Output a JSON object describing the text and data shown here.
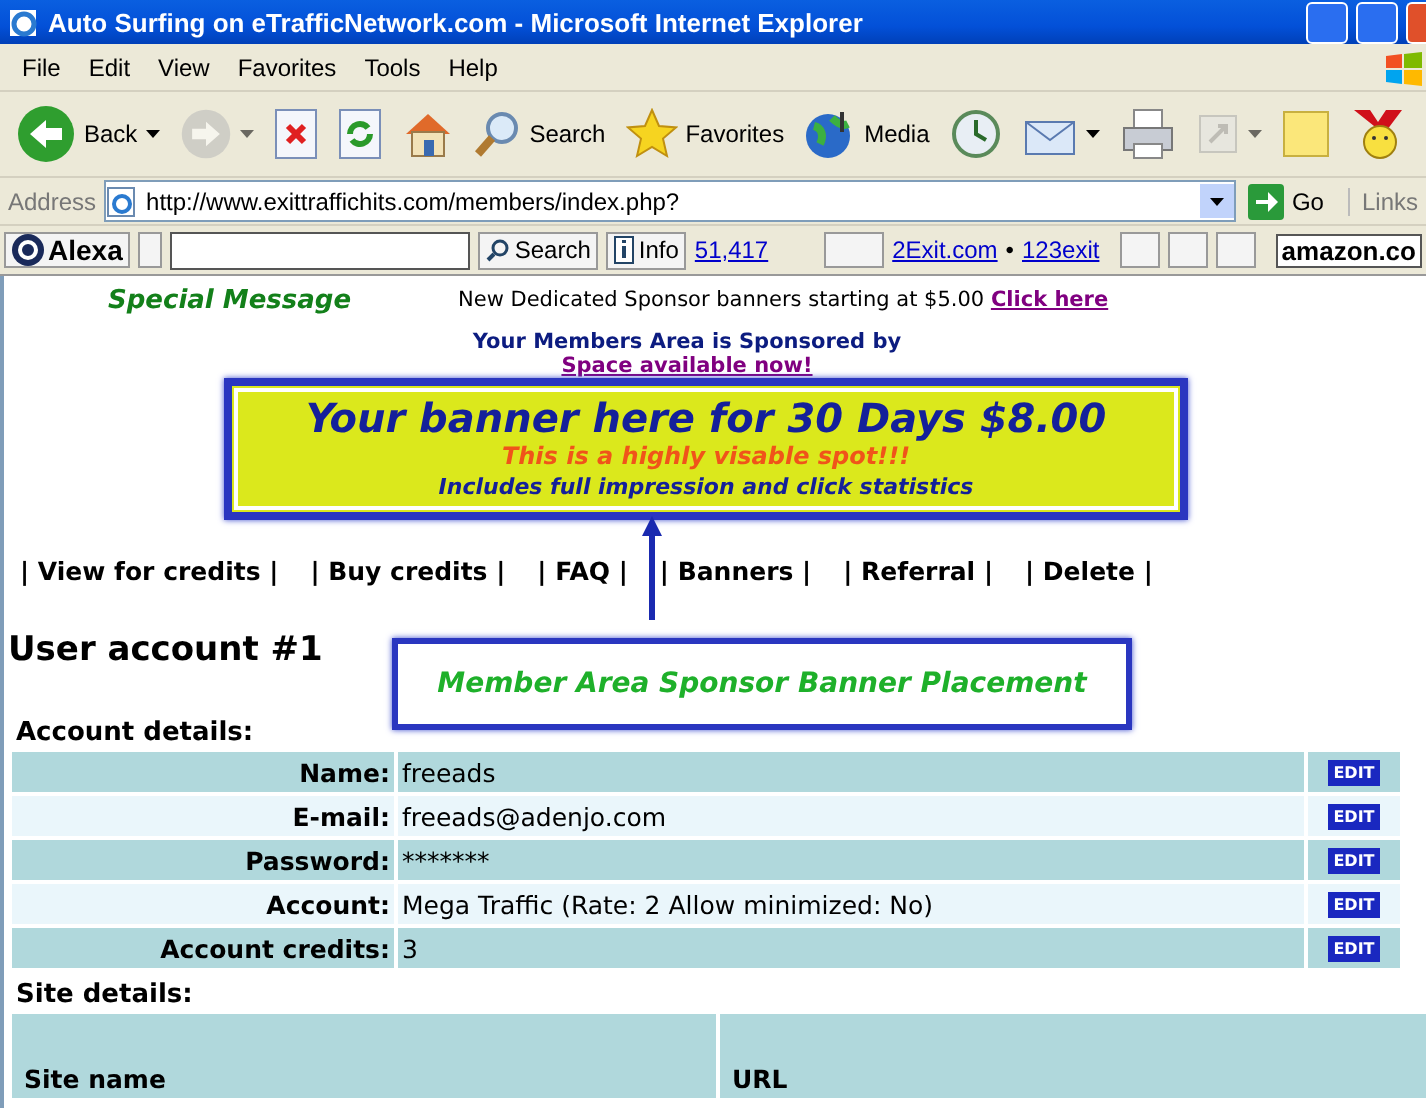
{
  "window": {
    "title": "Auto Surfing on eTrafficNetwork.com - Microsoft Internet Explorer"
  },
  "menu": [
    "File",
    "Edit",
    "View",
    "Favorites",
    "Tools",
    "Help"
  ],
  "toolbar": [
    {
      "kind": "back",
      "label": "Back",
      "dropdown": true,
      "disabled": false
    },
    {
      "kind": "forward",
      "dropdown": true,
      "disabled": true
    },
    {
      "kind": "stop",
      "dropdown": false,
      "disabled": false
    },
    {
      "kind": "refresh",
      "dropdown": false,
      "disabled": false
    },
    {
      "kind": "home",
      "dropdown": false,
      "disabled": false
    },
    {
      "kind": "search",
      "label": "Search",
      "dropdown": false,
      "disabled": false
    },
    {
      "kind": "favorites",
      "label": "Favorites",
      "dropdown": false,
      "disabled": false
    },
    {
      "kind": "media",
      "label": "Media",
      "dropdown": false,
      "disabled": false
    },
    {
      "kind": "history",
      "dropdown": false,
      "disabled": false
    },
    {
      "kind": "mail",
      "dropdown": true,
      "disabled": false
    },
    {
      "kind": "print",
      "dropdown": false,
      "disabled": false
    },
    {
      "kind": "edit",
      "dropdown": true,
      "disabled": true
    },
    {
      "kind": "note",
      "dropdown": false,
      "disabled": false
    },
    {
      "kind": "messenger",
      "dropdown": false,
      "disabled": false
    }
  ],
  "address": {
    "label": "Address",
    "url": "http://www.exittraffichits.com/members/index.php?",
    "go": "Go",
    "links": "Links"
  },
  "alexa": {
    "logo": "Alexa",
    "search": "Search",
    "info": "Info",
    "rank": "51,417",
    "link_1": "2Exit.com",
    "separator": "•",
    "link_2": "123exit",
    "shop": "amazon.co"
  },
  "page": {
    "special_title": "Special Message",
    "special_text": "New Dedicated Sponsor banners starting at $5.00",
    "special_link": "Click here",
    "sponsored_by": "Your Members Area is Sponsored by",
    "space_available": "Space available now!",
    "banner": {
      "headline": "Your banner here for 30 Days $8.00",
      "subline": "This is a highly visable spot!!!",
      "details": "Includes full impression and click statistics"
    },
    "nav": [
      "| View for credits |",
      "| Buy credits |",
      "| FAQ |",
      "| Banners |",
      "| Referral |",
      "| Delete |"
    ],
    "heading": "User account #1",
    "account_title": "Account details:",
    "account_rows": [
      {
        "label": "Name:",
        "value": "freeads",
        "action": "EDIT"
      },
      {
        "label": "E-mail:",
        "value": "freeads@adenjo.com",
        "action": "EDIT"
      },
      {
        "label": "Password:",
        "value": "*******",
        "action": "EDIT"
      },
      {
        "label": "Account:",
        "value": "Mega Traffic (Rate: 2 Allow minimized: No)",
        "action": "EDIT"
      },
      {
        "label": "Account credits:",
        "value": "3",
        "action": "EDIT"
      }
    ],
    "site_title": "Site details:",
    "site_columns": [
      "Site name",
      "URL"
    ]
  },
  "annotation": {
    "text": "Member Area Sponsor Banner Placement"
  }
}
